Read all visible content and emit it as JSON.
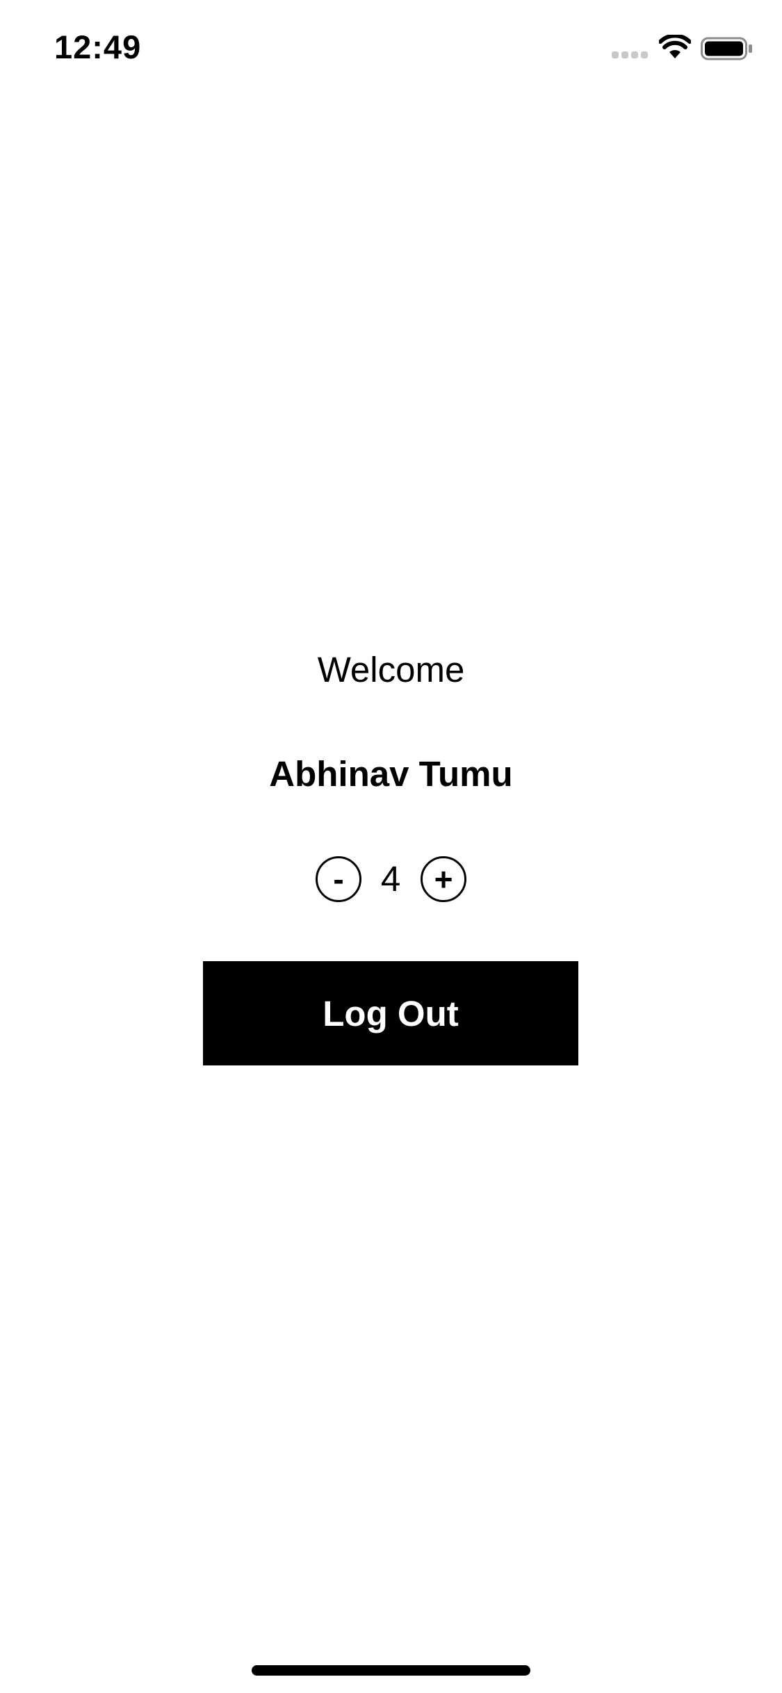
{
  "status_bar": {
    "time": "12:49",
    "icons": [
      "cellular-signal-icon",
      "wifi-icon",
      "battery-icon"
    ]
  },
  "main": {
    "welcome_text": "Welcome",
    "user_name": "Abhinav Tumu",
    "stepper": {
      "minus_label": "-",
      "value": "4",
      "plus_label": "+"
    },
    "logout_label": "Log Out"
  },
  "colors": {
    "background": "#ffffff",
    "text": "#000000",
    "button_bg": "#000000",
    "button_text": "#ffffff"
  }
}
